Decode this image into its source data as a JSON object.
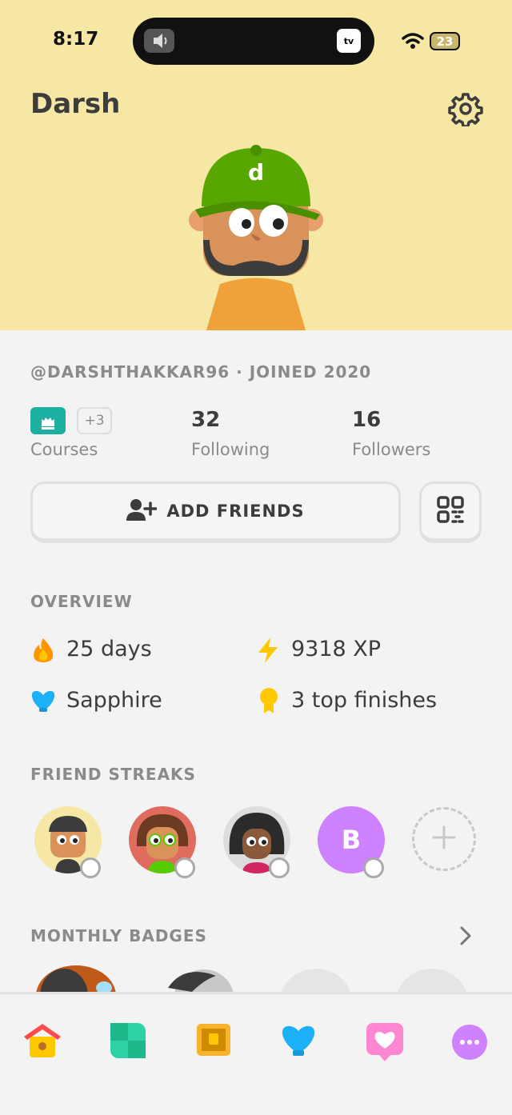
{
  "status_bar": {
    "time": "8:17",
    "battery": "23",
    "tv_label": "tv"
  },
  "profile": {
    "name": "Darsh",
    "handle_line": "@DARSHTHAKKAR96 · JOINED 2020",
    "cap_letter": "d"
  },
  "stats": {
    "courses_extra": "+3",
    "courses_label": "Courses",
    "following_count": "32",
    "following_label": "Following",
    "followers_count": "16",
    "followers_label": "Followers"
  },
  "actions": {
    "add_friends_label": "ADD FRIENDS"
  },
  "overview": {
    "heading": "OVERVIEW",
    "streak": "25 days",
    "xp": "9318 XP",
    "league": "Sapphire",
    "top_finishes": "3 top finishes"
  },
  "friend_streaks": {
    "heading": "FRIEND STREAKS",
    "friend_b_initial": "B"
  },
  "monthly_badges": {
    "heading": "MONTHLY BADGES"
  },
  "colors": {
    "header_bg": "#f7e7a5",
    "accent_green": "#58cc02",
    "course_flag": "#1cb0a0",
    "streak_orange": "#ff9600",
    "xp_yellow": "#ffc800",
    "sapphire_blue": "#1cb0f6",
    "friend_purple": "#ce82ff"
  },
  "tab_icons": [
    "home-icon",
    "practice-icon",
    "quests-icon",
    "leagues-icon",
    "friends-heart-icon",
    "more-icon"
  ]
}
